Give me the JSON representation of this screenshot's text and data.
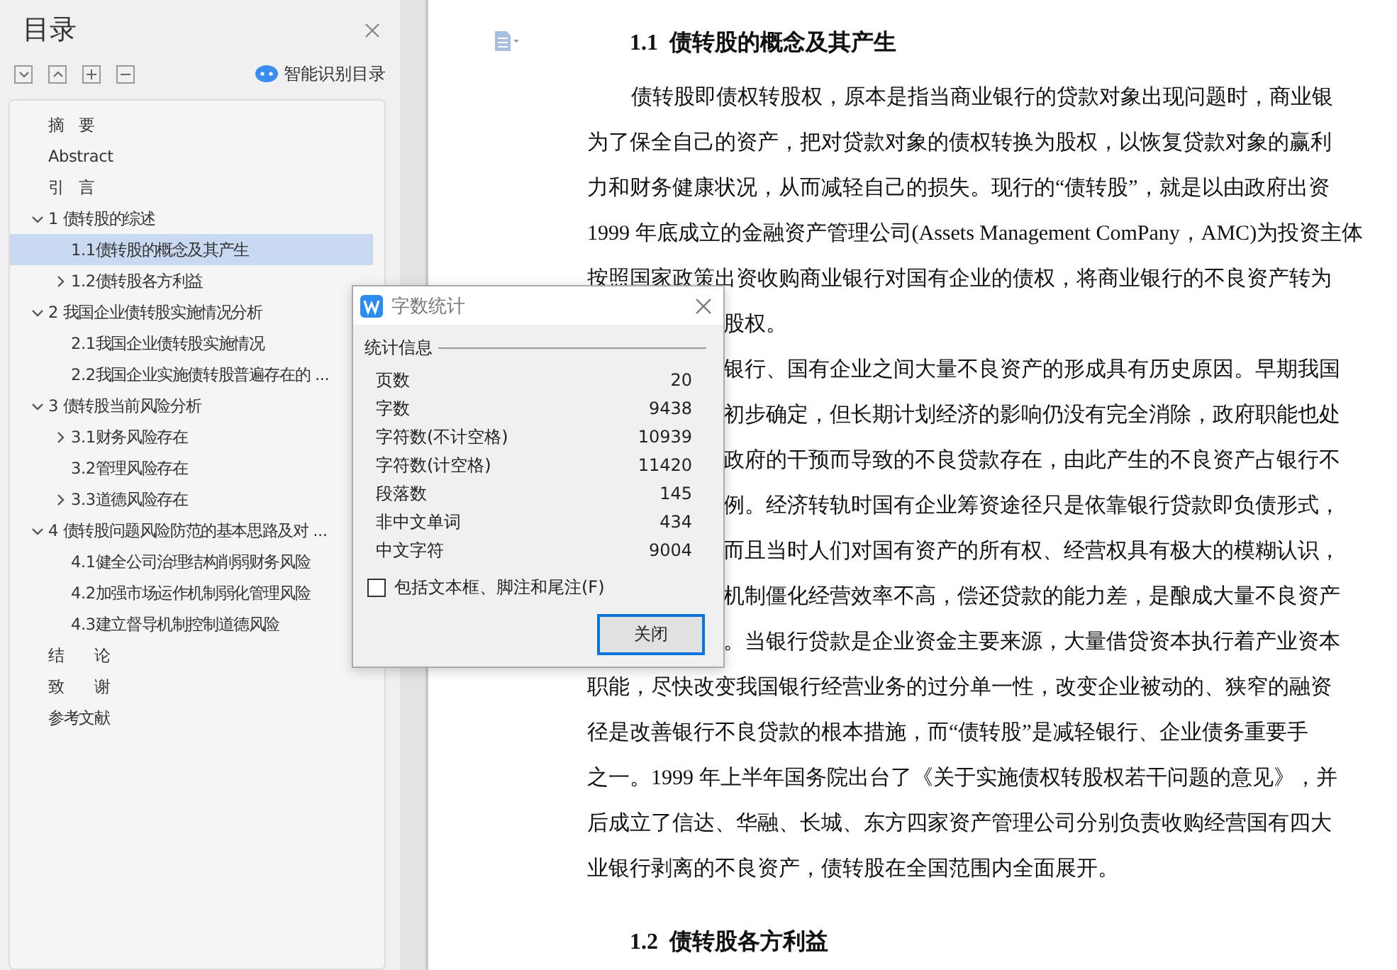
{
  "toc_panel": {
    "title": "目录",
    "smart_button": "智能识别目录",
    "items": [
      {
        "label": "摘　要",
        "kind": "leaf",
        "selected": false
      },
      {
        "label": "Abstract",
        "kind": "leaf",
        "selected": false
      },
      {
        "label": "引　言",
        "kind": "leaf",
        "selected": false
      },
      {
        "label": "1 债转股的综述",
        "kind": "branch",
        "expanded": true,
        "selected": false,
        "children": [
          {
            "label": "1.1债转股的概念及其产生",
            "kind": "leaf",
            "selected": true
          },
          {
            "label": "1.2债转股各方利益",
            "kind": "branch",
            "expanded": false,
            "selected": false
          }
        ]
      },
      {
        "label": "2  我国企业债转股实施情况分析",
        "kind": "branch",
        "expanded": true,
        "selected": false,
        "children": [
          {
            "label": "2.1我国企业债转股实施情况",
            "kind": "leaf",
            "selected": false
          },
          {
            "label": "2.2我国企业实施债转股普遍存在的 ...",
            "kind": "leaf",
            "selected": false
          }
        ]
      },
      {
        "label": "3  债转股当前风险分析",
        "kind": "branch",
        "expanded": true,
        "selected": false,
        "children": [
          {
            "label": "3.1财务风险存在",
            "kind": "branch",
            "expanded": false,
            "selected": false
          },
          {
            "label": "3.2管理风险存在",
            "kind": "leaf",
            "selected": false
          },
          {
            "label": "3.3道德风险存在",
            "kind": "branch",
            "expanded": false,
            "selected": false
          }
        ]
      },
      {
        "label": "4  债转股问题风险防范的基本思路及对 ...",
        "kind": "branch",
        "expanded": true,
        "selected": false,
        "children": [
          {
            "label": "4.1健全公司治理结构削弱财务风险",
            "kind": "leaf",
            "selected": false
          },
          {
            "label": "4.2加强市场运作机制弱化管理风险",
            "kind": "leaf",
            "selected": false
          },
          {
            "label": "4.3建立督导机制控制道德风险",
            "kind": "leaf",
            "selected": false
          }
        ]
      },
      {
        "label": "结　　论",
        "kind": "leaf",
        "selected": false
      },
      {
        "label": "致　　谢",
        "kind": "leaf",
        "selected": false
      },
      {
        "label": "参考文献",
        "kind": "leaf",
        "selected": false
      }
    ]
  },
  "document": {
    "blocks": [
      {
        "kind": "heading",
        "text": "1.1  债转股的概念及其产生"
      },
      {
        "kind": "indent",
        "text": "债转股即债权转股权，原本是指当商业银行的贷款对象出现问题时，商业银"
      },
      {
        "kind": "plain",
        "text": "为了保全自己的资产，把对贷款对象的债权转换为股权，以恢复贷款对象的赢利"
      },
      {
        "kind": "plain",
        "text": "力和财务健康状况，从而减轻自己的损失。现行的“债转股”，就是以由政府出资"
      },
      {
        "kind": "plain",
        "text": "1999 年底成立的金融资产管理公司(Assets Management ComPany，AMC)为投资主体"
      },
      {
        "kind": "plain",
        "text": "按照国家政策出资收购商业银行对国有企业的债权，将商业银行的不良资产转为"
      },
      {
        "kind": "covered",
        "text": "股权。"
      },
      {
        "kind": "covered",
        "text": "银行、国有企业之间大量不良资产的形成具有历史原因。早期我国"
      },
      {
        "kind": "covered",
        "text": "初步确定，但长期计划经济的影响仍没有完全消除，政府职能也处"
      },
      {
        "kind": "covered",
        "text": "政府的干预而导致的不良贷款存在，由此产生的不良资产占银行不"
      },
      {
        "kind": "covered",
        "text": "例。经济转轨时国有企业筹资途径只是依靠银行贷款即负债形式，"
      },
      {
        "kind": "covered",
        "text": "而且当时人们对国有资产的所有权、经营权具有极大的模糊认识，"
      },
      {
        "kind": "covered",
        "text": "机制僵化经营效率不高，偿还贷款的能力差，是酿成大量不良资产"
      },
      {
        "kind": "covered",
        "text": "。当银行贷款是企业资金主要来源，大量借贷资本执行着产业资本"
      },
      {
        "kind": "plain",
        "text": "职能，尽快改变我国银行经营业务的过分单一性，改变企业被动的、狭窄的融资"
      },
      {
        "kind": "plain",
        "text": "径是改善银行不良贷款的根本措施，而“债转股”是减轻银行、企业债务重要手"
      },
      {
        "kind": "plain",
        "text": "之一。1999 年上半年国务院出台了《关于实施债权转股权若干问题的意见》，并"
      },
      {
        "kind": "plain",
        "text": "后成立了信达、华融、长城、东方四家资产管理公司分别负责收购经营国有四大"
      },
      {
        "kind": "plain",
        "text": "业银行剥离的不良资产，债转股在全国范围内全面展开。"
      },
      {
        "kind": "heading",
        "text": "1.2  债转股各方利益"
      }
    ]
  },
  "dialog": {
    "title": "字数统计",
    "section": "统计信息",
    "rows": [
      {
        "label": "页数",
        "value": "20"
      },
      {
        "label": "字数",
        "value": "9438"
      },
      {
        "label": "字符数(不计空格)",
        "value": "10939"
      },
      {
        "label": "字符数(计空格)",
        "value": "11420"
      },
      {
        "label": "段落数",
        "value": "145"
      },
      {
        "label": "非中文单词",
        "value": "434"
      },
      {
        "label": "中文字符",
        "value": "9004"
      }
    ],
    "checkbox": {
      "label": "包括文本框、脚注和尾注(F)",
      "checked": false
    },
    "button": "关闭"
  }
}
